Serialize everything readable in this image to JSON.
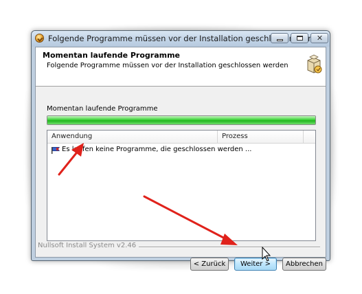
{
  "window": {
    "title": "Folgende Programme müssen vor der Installation geschlossen werden"
  },
  "header": {
    "title": "Momentan laufende Programme",
    "subtitle": "Folgende Programme müssen vor der Installation geschlossen werden",
    "icon": "installer-box-icon"
  },
  "panel": {
    "label": "Momentan laufende Programme",
    "progress_percent": 100
  },
  "list": {
    "columns": [
      "Anwendung",
      "Prozess"
    ],
    "rows": [
      {
        "text": "Es laufen keine Programme, die geschlossen werden ..."
      }
    ]
  },
  "footer": {
    "system_text": "Nullsoft Install System v2.46"
  },
  "buttons": {
    "back": "< Zurück",
    "next": "Weiter >",
    "cancel": "Abbrechen"
  },
  "colors": {
    "annotation_arrow": "#e0221b",
    "progress": "#2bc026",
    "title_bar": "#c6d7ea"
  }
}
